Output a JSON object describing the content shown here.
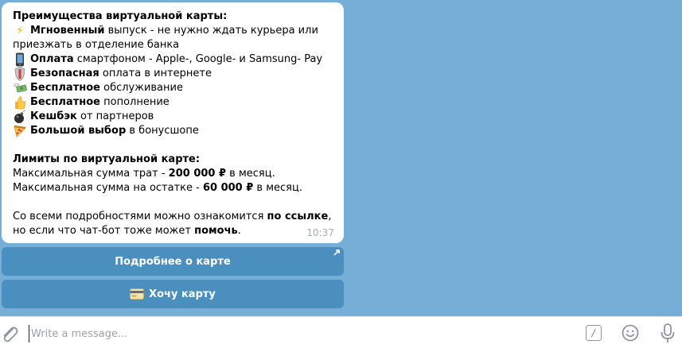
{
  "message": {
    "heading": "Преимущества виртуальной карты:",
    "benefits": [
      {
        "icon": "lightning-icon",
        "bold": "Мгновенный",
        "text": " выпуск - не нужно ждать курьера или приезжать в отделение банка"
      },
      {
        "icon": "smartphone-icon",
        "bold": "Оплата",
        "text": " смартфоном - Apple-, Google- и Samsung- Pay"
      },
      {
        "icon": "shield-icon",
        "bold": "Безопасная",
        "text": " оплата в интернете"
      },
      {
        "icon": "money-wings-icon",
        "bold": "Бесплатное",
        "text": " обслуживание"
      },
      {
        "icon": "thumbs-up-icon",
        "bold": "Бесплатное",
        "text": " пополнение"
      },
      {
        "icon": "bomb-icon",
        "bold": "Кешбэк",
        "text": " от партнеров"
      },
      {
        "icon": "pizza-icon",
        "bold": "Большой выбор",
        "text": " в бонусшопе"
      }
    ],
    "limits_heading": "Лимиты по виртуальной карте:",
    "limit_spend_label": "Максимальная сумма трат - ",
    "limit_spend_value": "200 000 ₽",
    "limit_spend_suffix": " в месяц.",
    "limit_balance_label": "Максимальная сумма на остатке - ",
    "limit_balance_value": "60 000 ₽",
    "limit_balance_suffix": " в месяц.",
    "details_prefix": "Со всеми подробностями можно ознакомится ",
    "details_link": "по ссылке",
    "details_middle": ", но если что чат-бот тоже может ",
    "details_bold": "помочь",
    "details_end": ".",
    "time": "10:37"
  },
  "keyboard": {
    "more_label": "Подробнее о карте",
    "want_label": "Хочу карту"
  },
  "composer": {
    "placeholder": "Write a message...",
    "command_symbol": "/"
  },
  "colors": {
    "chat_background": "#75afd8",
    "keyboard_button": "#4b8fbf"
  }
}
